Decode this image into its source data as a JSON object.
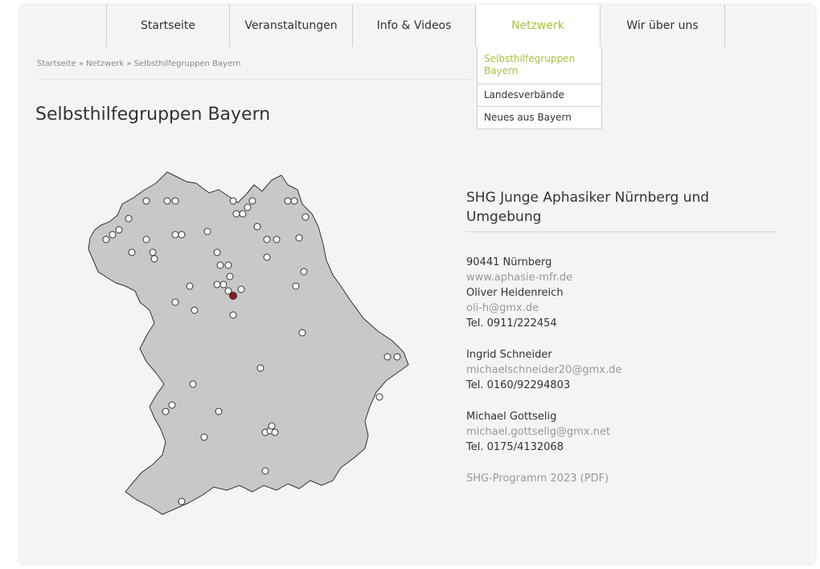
{
  "nav": {
    "items": [
      "Startseite",
      "Veranstaltungen",
      "Info & Videos",
      "Netzwerk",
      "Wir über uns"
    ],
    "active": "Netzwerk",
    "accent_color": "#a6c43a"
  },
  "dropdown": {
    "items": [
      "Selbsthilfegruppen Bayern",
      "Landesverbände",
      "Neues aus Bayern"
    ]
  },
  "breadcrumb": {
    "items": [
      "Startseite",
      "Netzwerk",
      "Selbsthilfegruppen Bayern"
    ],
    "separator": " » "
  },
  "page": {
    "title": "Selbsthilfegruppen Bayern"
  },
  "group": {
    "title": "SHG Junge Aphasiker Nürnberg und Umgebung",
    "address": "90441 Nürnberg",
    "website": "www.aphasie-mfr.de",
    "contacts": [
      {
        "name": "Oliver Heidenreich",
        "email": "oli-h@gmx.de",
        "phone": "Tel. 0911/222454"
      },
      {
        "name": "Ingrid Schneider",
        "email": "michaelschneider20@gmx.de",
        "phone": "Tel. 0160/92294803"
      },
      {
        "name": "Michael Gottselig",
        "email": "michael.gottselig@gmx.net",
        "phone": "Tel. 0175/4132068"
      }
    ],
    "program_link": "SHG-Programm 2023 (PDF)"
  },
  "map": {
    "region_fill": "#c8c8c8",
    "selected_color": "#8b1a1a"
  }
}
